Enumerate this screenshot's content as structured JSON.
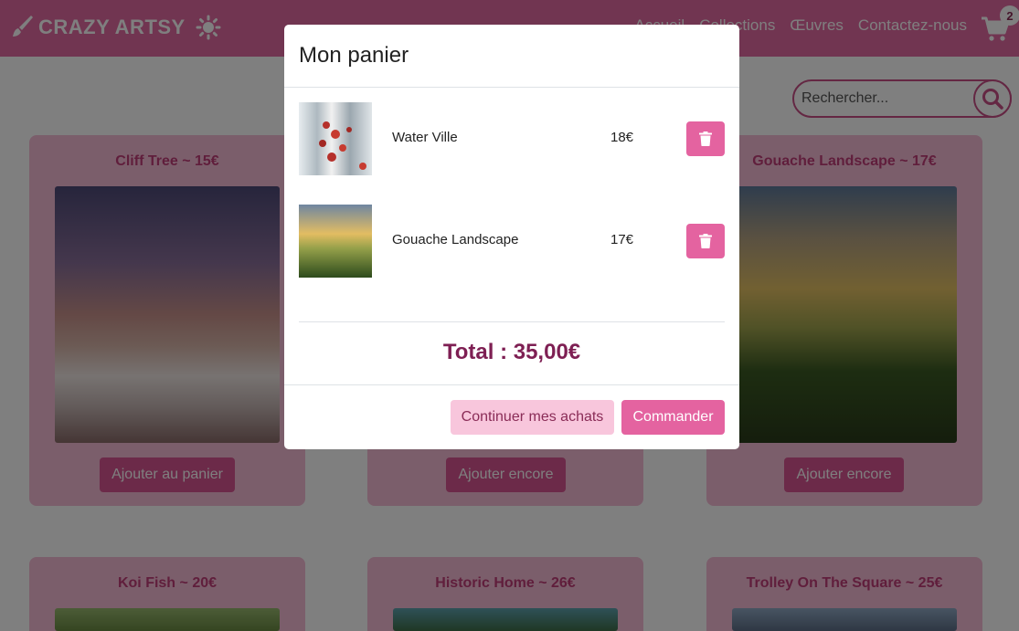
{
  "navbar": {
    "brand": "CRAZY ARTSY",
    "brand_icon": "paintbrush-icon",
    "theme_icon": "sun-icon",
    "links": [
      "Accueil",
      "Collections",
      "Œuvres",
      "Contactez-nous"
    ],
    "cart_icon": "shopping-cart-icon",
    "cart_count": "2"
  },
  "search": {
    "placeholder": "Rechercher...",
    "icon": "search-icon"
  },
  "products": [
    {
      "title": "Cliff Tree ~ 15€",
      "button": "Ajouter au panier"
    },
    {
      "title": "",
      "button": "Ajouter encore"
    },
    {
      "title": "Gouache Landscape ~ 17€",
      "button": "Ajouter encore"
    },
    {
      "title": "Koi Fish ~ 20€"
    },
    {
      "title": "Historic Home ~ 26€"
    },
    {
      "title": "Trolley On The Square ~ 25€"
    }
  ],
  "modal": {
    "title": "Mon panier",
    "items": [
      {
        "name": "Water Ville",
        "price": "18€"
      },
      {
        "name": "Gouache Landscape",
        "price": "17€"
      }
    ],
    "delete_icon": "trash-icon",
    "total": "Total : 35,00€",
    "continue_label": "Continuer mes achats",
    "order_label": "Commander"
  },
  "colors": {
    "navbar": "#e26aa2",
    "card_bg": "#f7bcd6",
    "primary": "#e463a0",
    "secondary": "#f8c6dc",
    "total_text": "#7e1f53"
  }
}
